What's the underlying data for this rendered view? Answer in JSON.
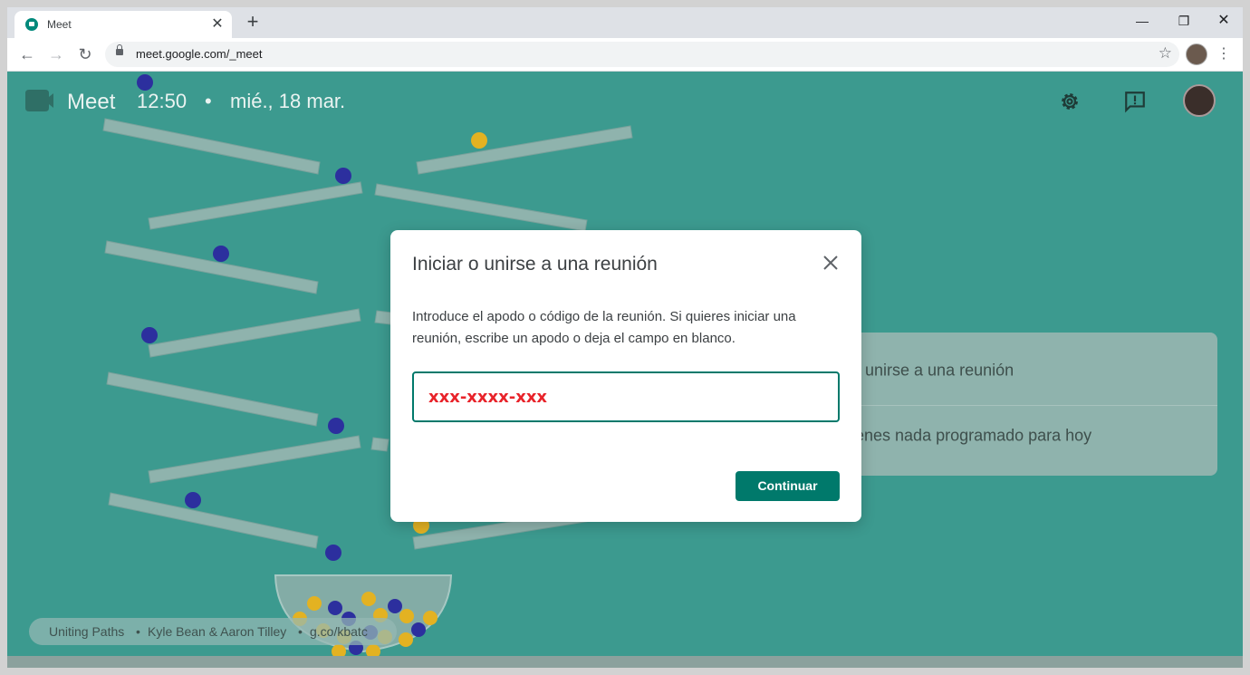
{
  "browser": {
    "tab_title": "Meet",
    "url": "meet.google.com/_meet"
  },
  "header": {
    "app_name": "Meet",
    "time": "12:50",
    "separator": "•",
    "date": "mié., 18 mar."
  },
  "side_card": {
    "join_label": "o unirse a una reunión",
    "empty_label": "ienes nada programado para hoy"
  },
  "dialog": {
    "title": "Iniciar o unirse a una reunión",
    "description": "Introduce el apodo o código de la reunión. Si quieres iniciar una reunión, escribe un apodo o deja el campo en blanco.",
    "input_placeholder": "xxx-xxxx-xxx",
    "continue_label": "Continuar"
  },
  "attribution": {
    "title": "Uniting Paths",
    "author": "Kyle Bean & Aaron Tilley",
    "link": "g.co/kbatc",
    "separator": "•"
  },
  "colors": {
    "background": "#3c9a8f",
    "accent": "#00796b",
    "input_text": "#e8232a"
  },
  "icons": [
    "meet-logo-icon",
    "settings-icon",
    "feedback-icon",
    "close-icon",
    "lock-icon",
    "star-icon",
    "back-icon",
    "forward-icon",
    "reload-icon",
    "kebab-menu-icon"
  ]
}
